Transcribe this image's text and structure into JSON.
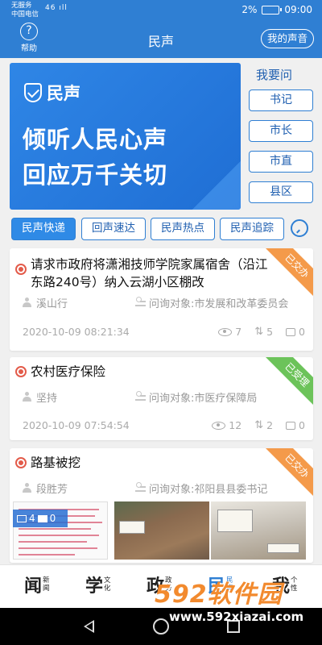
{
  "status_bar": {
    "carrier_line1": "无服务",
    "carrier_line2": "中国电信",
    "signal": "46 ıll",
    "battery": "2%",
    "time": "09:00"
  },
  "header": {
    "help_label": "帮助",
    "title": "民声",
    "my_voice": "我的声音"
  },
  "banner": {
    "logo_text": "民声",
    "slogan_line1": "倾听人民心声",
    "slogan_line2": "回应万千关切"
  },
  "ask": {
    "title": "我要问",
    "buttons": [
      "书记",
      "市长",
      "市直",
      "县区"
    ]
  },
  "tabs": [
    "民声快递",
    "回声速达",
    "民声热点",
    "民声追踪"
  ],
  "posts": [
    {
      "title": "请求市政府将潇湘技师学院家属宿舍（沿江东路240号）纳入云湖小区棚改",
      "author": "溪山行",
      "target": "问询对象:市发展和改革委员会",
      "date": "2020-10-09 08:21:34",
      "views": "7",
      "shares": "5",
      "comments": "0",
      "status": "已交办",
      "status_color": "#f49a4a"
    },
    {
      "title": "农村医疗保险",
      "author": "坚持",
      "target": "问询对象:市医疗保障局",
      "date": "2020-10-09 07:54:54",
      "views": "12",
      "shares": "2",
      "comments": "0",
      "status": "已受理",
      "status_color": "#6cc35a"
    },
    {
      "title": "路基被挖",
      "author": "段胜芳",
      "target": "问询对象:祁阳县县委书记",
      "status": "已交办",
      "status_color": "#f49a4a",
      "image_badge_mail": "4",
      "image_badge_pics": "0"
    }
  ],
  "bottom_nav": [
    {
      "big": "闻",
      "small1": "新",
      "small2": "闻"
    },
    {
      "big": "学",
      "small1": "文",
      "small2": "化"
    },
    {
      "big": "政",
      "small1": "政",
      "small2": "务"
    },
    {
      "big": "民",
      "small1": "民",
      "small2": "声"
    },
    {
      "big": "我",
      "small1": "个",
      "small2": "性"
    }
  ],
  "watermark": {
    "text": "592软件园",
    "url": "www.592xiazai.com"
  },
  "colors": {
    "primary": "#2f7fd3",
    "accent_orange": "#f49a4a",
    "accent_green": "#6cc35a",
    "dot_red": "#e35b4a"
  }
}
